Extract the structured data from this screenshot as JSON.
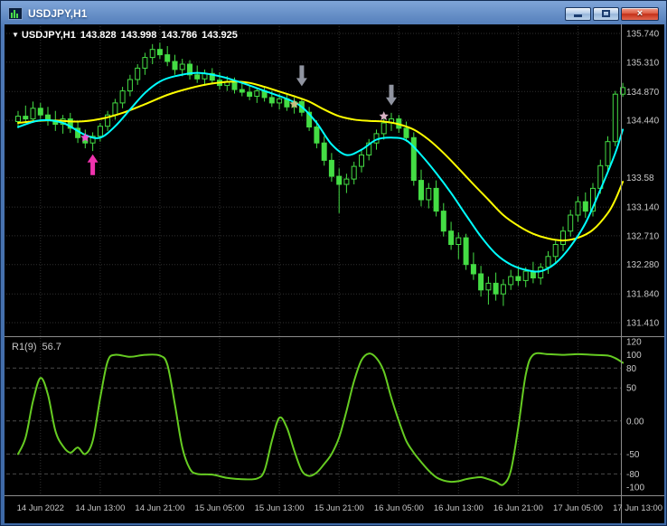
{
  "window": {
    "title": "USDJPY,H1",
    "close_icon": "×"
  },
  "chart_data": {
    "type": "candlestick+oscillator",
    "header": {
      "dropdown_icon": "▼",
      "symbol": "USDJPY,H1",
      "open": "143.828",
      "high": "143.998",
      "low": "143.786",
      "close": "143.925"
    },
    "price_axis": {
      "labels": [
        {
          "text": "135.740",
          "value": 135.74
        },
        {
          "text": "135.310",
          "value": 135.31
        },
        {
          "text": "134.870",
          "value": 134.87
        },
        {
          "text": "134.440",
          "value": 134.44
        },
        {
          "text": "133.58",
          "value": 133.58
        },
        {
          "text": "133.140",
          "value": 133.14
        },
        {
          "text": "132.710",
          "value": 132.71
        },
        {
          "text": "132.280",
          "value": 132.28
        },
        {
          "text": "131.840",
          "value": 131.84
        },
        {
          "text": "131.410",
          "value": 131.41
        }
      ]
    },
    "time_axis": {
      "labels": [
        "14 Jun 2022",
        "14 Jun 13:00",
        "14 Jun 21:00",
        "15 Jun 05:00",
        "15 Jun 13:00",
        "15 Jun 21:00",
        "16 Jun 05:00",
        "16 Jun 13:00",
        "16 Jun 21:00",
        "17 Jun 05:00",
        "17 Jun 13:00"
      ]
    },
    "candles": [
      [
        134.42,
        134.58,
        134.32,
        134.5
      ],
      [
        134.5,
        134.66,
        134.42,
        134.46
      ],
      [
        134.46,
        134.72,
        134.4,
        134.62
      ],
      [
        134.62,
        134.7,
        134.46,
        134.52
      ],
      [
        134.52,
        134.64,
        134.36,
        134.44
      ],
      [
        134.44,
        134.58,
        134.28,
        134.38
      ],
      [
        134.38,
        134.52,
        134.24,
        134.46
      ],
      [
        134.46,
        134.55,
        134.25,
        134.32
      ],
      [
        134.32,
        134.42,
        134.1,
        134.18
      ],
      [
        134.18,
        134.3,
        134.02,
        134.1
      ],
      [
        134.1,
        134.26,
        133.98,
        134.2
      ],
      [
        134.2,
        134.4,
        134.12,
        134.35
      ],
      [
        134.35,
        134.58,
        134.28,
        134.52
      ],
      [
        134.52,
        134.76,
        134.45,
        134.7
      ],
      [
        134.7,
        134.94,
        134.62,
        134.88
      ],
      [
        134.88,
        135.12,
        134.8,
        135.05
      ],
      [
        135.05,
        135.28,
        134.97,
        135.22
      ],
      [
        135.22,
        135.45,
        135.12,
        135.38
      ],
      [
        135.38,
        135.58,
        135.28,
        135.5
      ],
      [
        135.5,
        135.6,
        135.36,
        135.42
      ],
      [
        135.42,
        135.55,
        135.25,
        135.32
      ],
      [
        135.32,
        135.42,
        135.12,
        135.2
      ],
      [
        135.2,
        135.36,
        135.1,
        135.28
      ],
      [
        135.28,
        135.34,
        135.05,
        135.12
      ],
      [
        135.12,
        135.26,
        135.0,
        135.06
      ],
      [
        135.06,
        135.2,
        134.96,
        135.14
      ],
      [
        135.14,
        135.22,
        134.98,
        135.04
      ],
      [
        135.04,
        135.16,
        134.9,
        134.96
      ],
      [
        134.96,
        135.1,
        134.88,
        135.02
      ],
      [
        135.02,
        135.08,
        134.84,
        134.9
      ],
      [
        134.9,
        135.02,
        134.8,
        134.86
      ],
      [
        134.86,
        134.96,
        134.74,
        134.8
      ],
      [
        134.8,
        134.92,
        134.7,
        134.88
      ],
      [
        134.88,
        134.94,
        134.72,
        134.78
      ],
      [
        134.78,
        134.88,
        134.64,
        134.7
      ],
      [
        134.7,
        134.84,
        134.6,
        134.76
      ],
      [
        134.76,
        134.82,
        134.58,
        134.64
      ],
      [
        134.64,
        134.78,
        134.54,
        134.72
      ],
      [
        134.72,
        134.76,
        134.5,
        134.56
      ],
      [
        134.56,
        134.64,
        134.28,
        134.34
      ],
      [
        134.34,
        134.44,
        134.02,
        134.1
      ],
      [
        134.1,
        134.2,
        133.76,
        133.84
      ],
      [
        133.84,
        133.95,
        133.52,
        133.6
      ],
      [
        133.6,
        133.72,
        133.05,
        133.48
      ],
      [
        133.48,
        133.64,
        133.35,
        133.56
      ],
      [
        133.56,
        133.82,
        133.48,
        133.75
      ],
      [
        133.75,
        134.0,
        133.66,
        133.92
      ],
      [
        133.92,
        134.16,
        133.84,
        134.1
      ],
      [
        134.1,
        134.3,
        134.0,
        134.24
      ],
      [
        134.24,
        134.46,
        134.15,
        134.4
      ],
      [
        134.4,
        134.55,
        134.28,
        134.46
      ],
      [
        134.46,
        134.52,
        134.25,
        134.32
      ],
      [
        134.32,
        134.42,
        134.12,
        134.18
      ],
      [
        134.18,
        134.26,
        133.46,
        133.54
      ],
      [
        133.54,
        133.7,
        133.15,
        133.25
      ],
      [
        133.25,
        133.5,
        133.12,
        133.42
      ],
      [
        133.42,
        133.54,
        133.0,
        133.08
      ],
      [
        133.08,
        133.2,
        132.7,
        132.78
      ],
      [
        132.78,
        132.92,
        132.5,
        132.58
      ],
      [
        132.58,
        132.76,
        132.36,
        132.68
      ],
      [
        132.68,
        132.74,
        132.2,
        132.28
      ],
      [
        132.28,
        132.46,
        132.05,
        132.14
      ],
      [
        132.14,
        132.26,
        131.8,
        131.9
      ],
      [
        131.9,
        132.1,
        131.68,
        132.0
      ],
      [
        132.0,
        132.16,
        131.74,
        131.84
      ],
      [
        131.84,
        132.06,
        131.66,
        131.98
      ],
      [
        131.98,
        132.2,
        131.9,
        132.1
      ],
      [
        132.1,
        132.26,
        131.96,
        132.04
      ],
      [
        132.04,
        132.24,
        131.94,
        132.18
      ],
      [
        132.18,
        132.32,
        132.0,
        132.08
      ],
      [
        132.08,
        132.3,
        131.98,
        132.24
      ],
      [
        132.24,
        132.48,
        132.14,
        132.4
      ],
      [
        132.4,
        132.65,
        132.3,
        132.58
      ],
      [
        132.58,
        132.85,
        132.48,
        132.78
      ],
      [
        132.78,
        133.1,
        132.7,
        133.02
      ],
      [
        133.02,
        133.3,
        132.92,
        133.22
      ],
      [
        133.22,
        133.36,
        132.98,
        133.08
      ],
      [
        133.08,
        133.5,
        133.0,
        133.42
      ],
      [
        133.42,
        133.85,
        133.34,
        133.76
      ],
      [
        133.76,
        134.2,
        133.68,
        134.12
      ],
      [
        134.12,
        134.88,
        134.05,
        134.83
      ],
      [
        134.83,
        135.0,
        134.79,
        134.93
      ]
    ],
    "ma_fast": {
      "color": "#00FFFF",
      "points": [
        [
          0,
          134.34
        ],
        [
          3,
          134.44
        ],
        [
          6,
          134.4
        ],
        [
          9,
          134.22
        ],
        [
          11,
          134.18
        ],
        [
          13,
          134.35
        ],
        [
          15,
          134.6
        ],
        [
          17,
          134.85
        ],
        [
          19,
          135.02
        ],
        [
          21,
          135.1
        ],
        [
          24,
          135.15
        ],
        [
          27,
          135.1
        ],
        [
          30,
          135.0
        ],
        [
          33,
          134.88
        ],
        [
          36,
          134.76
        ],
        [
          38,
          134.64
        ],
        [
          40,
          134.4
        ],
        [
          42,
          134.08
        ],
        [
          44,
          133.92
        ],
        [
          46,
          134.0
        ],
        [
          48,
          134.15
        ],
        [
          50,
          134.18
        ],
        [
          52,
          134.14
        ],
        [
          54,
          133.92
        ],
        [
          56,
          133.65
        ],
        [
          58,
          133.35
        ],
        [
          60,
          133.02
        ],
        [
          62,
          132.7
        ],
        [
          64,
          132.44
        ],
        [
          66,
          132.28
        ],
        [
          68,
          132.2
        ],
        [
          70,
          132.18
        ],
        [
          72,
          132.3
        ],
        [
          74,
          132.55
        ],
        [
          76,
          132.9
        ],
        [
          78,
          133.4
        ],
        [
          80,
          133.95
        ],
        [
          81,
          134.3
        ]
      ]
    },
    "ma_slow": {
      "color": "#FFFF00",
      "points": [
        [
          0,
          134.4
        ],
        [
          4,
          134.44
        ],
        [
          8,
          134.42
        ],
        [
          11,
          134.46
        ],
        [
          14,
          134.55
        ],
        [
          17,
          134.68
        ],
        [
          20,
          134.82
        ],
        [
          23,
          134.92
        ],
        [
          26,
          134.99
        ],
        [
          29,
          135.02
        ],
        [
          31,
          135.0
        ],
        [
          33,
          134.94
        ],
        [
          35,
          134.87
        ],
        [
          37,
          134.8
        ],
        [
          39,
          134.72
        ],
        [
          41,
          134.6
        ],
        [
          43,
          134.5
        ],
        [
          45,
          134.45
        ],
        [
          47,
          134.43
        ],
        [
          49,
          134.42
        ],
        [
          51,
          134.38
        ],
        [
          53,
          134.3
        ],
        [
          55,
          134.15
        ],
        [
          57,
          133.95
        ],
        [
          59,
          133.72
        ],
        [
          61,
          133.48
        ],
        [
          63,
          133.25
        ],
        [
          65,
          133.02
        ],
        [
          67,
          132.86
        ],
        [
          69,
          132.74
        ],
        [
          71,
          132.67
        ],
        [
          73,
          132.64
        ],
        [
          75,
          132.68
        ],
        [
          77,
          132.8
        ],
        [
          79,
          133.05
        ],
        [
          80,
          133.25
        ],
        [
          81,
          133.52
        ]
      ]
    },
    "indicator": {
      "name": "R1(9)",
      "value": "56.7",
      "color": "#66CC22",
      "levels": [
        80,
        50,
        0,
        -50,
        -80
      ],
      "axis_labels": [
        {
          "text": "120",
          "value": 120
        },
        {
          "text": "100",
          "value": 100
        },
        {
          "text": "80",
          "value": 80
        },
        {
          "text": "50",
          "value": 50
        },
        {
          "text": "0.00",
          "value": 0
        },
        {
          "text": "-50",
          "value": -50
        },
        {
          "text": "-80",
          "value": -80
        },
        {
          "text": "-100",
          "value": -100
        }
      ],
      "points": [
        [
          0,
          -50
        ],
        [
          1,
          -25
        ],
        [
          2,
          30
        ],
        [
          3,
          65
        ],
        [
          4,
          40
        ],
        [
          5,
          -15
        ],
        [
          6,
          -38
        ],
        [
          7,
          -48
        ],
        [
          8,
          -40
        ],
        [
          9,
          -50
        ],
        [
          10,
          -30
        ],
        [
          11,
          35
        ],
        [
          12,
          90
        ],
        [
          13,
          100
        ],
        [
          15,
          97
        ],
        [
          17,
          100
        ],
        [
          19,
          99
        ],
        [
          20,
          85
        ],
        [
          21,
          25
        ],
        [
          22,
          -40
        ],
        [
          23,
          -72
        ],
        [
          24,
          -80
        ],
        [
          26,
          -81
        ],
        [
          28,
          -86
        ],
        [
          30,
          -88
        ],
        [
          32,
          -87
        ],
        [
          33,
          -75
        ],
        [
          34,
          -30
        ],
        [
          35,
          5
        ],
        [
          36,
          -10
        ],
        [
          37,
          -45
        ],
        [
          38,
          -75
        ],
        [
          39,
          -83
        ],
        [
          40,
          -78
        ],
        [
          41,
          -65
        ],
        [
          42,
          -50
        ],
        [
          43,
          -25
        ],
        [
          44,
          15
        ],
        [
          45,
          60
        ],
        [
          46,
          92
        ],
        [
          47,
          102
        ],
        [
          48,
          95
        ],
        [
          49,
          75
        ],
        [
          50,
          35
        ],
        [
          51,
          0
        ],
        [
          52,
          -30
        ],
        [
          53,
          -48
        ],
        [
          54,
          -62
        ],
        [
          55,
          -75
        ],
        [
          56,
          -85
        ],
        [
          57,
          -90
        ],
        [
          58,
          -92
        ],
        [
          59,
          -91
        ],
        [
          60,
          -88
        ],
        [
          61,
          -86
        ],
        [
          62,
          -85
        ],
        [
          63,
          -88
        ],
        [
          64,
          -92
        ],
        [
          65,
          -96
        ],
        [
          66,
          -75
        ],
        [
          67,
          -10
        ],
        [
          68,
          70
        ],
        [
          69,
          100
        ],
        [
          71,
          101
        ],
        [
          73,
          100
        ],
        [
          75,
          101
        ],
        [
          77,
          100
        ],
        [
          79,
          99
        ],
        [
          80,
          95
        ],
        [
          81,
          88
        ]
      ]
    },
    "markers": [
      {
        "type": "star",
        "index": 9,
        "price": 134.18,
        "color": "#F04FD0",
        "name": "buy-signal-star"
      },
      {
        "type": "arrow-up",
        "index": 10,
        "price": 133.93,
        "color": "#F033AE",
        "name": "buy-arrow"
      },
      {
        "type": "star",
        "index": 37,
        "price": 134.68,
        "color": "#C8BE82",
        "name": "sell-signal-star-1"
      },
      {
        "type": "arrow-down",
        "index": 38,
        "price": 134.95,
        "color": "#9094A0",
        "name": "sell-arrow-1"
      },
      {
        "type": "star",
        "index": 49,
        "price": 134.5,
        "color": "#D8B2C4",
        "name": "sell-signal-star-2"
      },
      {
        "type": "arrow-down",
        "index": 50,
        "price": 134.66,
        "color": "#9094A0",
        "name": "sell-arrow-2"
      }
    ],
    "colors": {
      "background": "#000000",
      "grid": "#303030",
      "candle": "#44DD44",
      "separator": "#8C8C8C",
      "axis_text": "#C8C8C8",
      "header_text": "#FFFFFF"
    }
  }
}
